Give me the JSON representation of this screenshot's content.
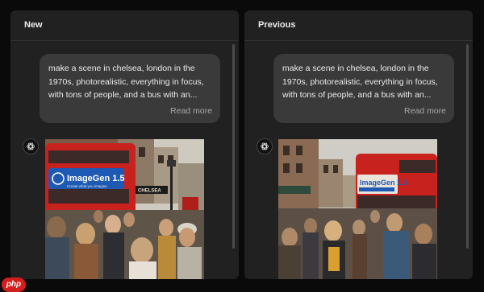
{
  "panels": {
    "left": {
      "title": "New",
      "prompt": "make a scene in chelsea, london in the 1970s, photorealistic, everything in focus, with tons of people, and a bus with an...",
      "read_more": "Read more",
      "image": {
        "banner_title": "ImageGen 1.5",
        "banner_subtitle": "Create what you imagine",
        "shop_sign": "CHELSEA"
      }
    },
    "right": {
      "title": "Previous",
      "prompt": "make a scene in chelsea, london in the 1970s, photorealistic, everything in focus, with tons of people, and a bus with an...",
      "read_more": "Read more",
      "image": {
        "banner_title": "ImageGen 1.5"
      }
    }
  },
  "watermark": "php",
  "icons": {
    "assistant_avatar": "openai-logo-icon"
  },
  "colors": {
    "page_bg": "#0a0a0a",
    "panel_bg": "#212121",
    "bubble_bg": "#3a3a3a",
    "bus_red": "#c8221f",
    "banner_blue": "#1e5ab4",
    "watermark_red": "#d41e1e"
  }
}
